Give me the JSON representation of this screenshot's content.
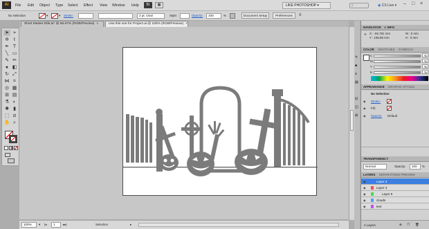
{
  "app": {
    "logo": "Ai",
    "workspace": "LIKE PHOTOSHOP",
    "cs_live": "CS Live"
  },
  "menu": [
    "File",
    "Edit",
    "Object",
    "Type",
    "Select",
    "Effect",
    "View",
    "Window",
    "Help"
  ],
  "control": {
    "selection_label": "No Selection",
    "stroke_label": "Stroke:",
    "brush": "2 pt. Oval",
    "style_label": "Style:",
    "opacity_label": "Opacity:",
    "opacity_value": "100",
    "opacity_unit": "%",
    "doc_setup": "Document Setup",
    "preferences": "Preferences"
  },
  "doc_tabs": [
    {
      "label": "Short Master Ebb.ai* @ 66.67% (RGB/Preview)"
    },
    {
      "label": "Use this one for Project.ai @ 100% (RGB/Preview)"
    }
  ],
  "status": {
    "zoom": "100%",
    "page": "1",
    "mode": "Selection"
  },
  "navigator": {
    "tabs": [
      "NAVIGATOR",
      "INFO"
    ],
    "x": "X : -92.781 mm",
    "y": "Y : 196.85 mm",
    "w": "W : 0 mm",
    "h": "H : 0 mm"
  },
  "color_panel": {
    "tabs": [
      "COLOR",
      "SWATCHES",
      "SYMBOLS"
    ],
    "channels": [
      {
        "label": "C",
        "value": "",
        "unit": "%"
      },
      {
        "label": "M",
        "value": "",
        "unit": "%"
      },
      {
        "label": "Y",
        "value": "",
        "unit": "%"
      },
      {
        "label": "K",
        "value": "",
        "unit": "%"
      }
    ]
  },
  "appearance": {
    "tabs": [
      "APPEARANCE",
      "GRAPHIC STYLES"
    ],
    "header": "No Selection",
    "stroke": "Stroke:",
    "fill": "Fill:",
    "opacity": "Opacity:",
    "opacity_value": "Default"
  },
  "transparency": {
    "title": "TRANSPARENCY",
    "mode": "Normal",
    "opacity_label": "Opacity:",
    "opacity_value": "100",
    "opacity_unit": "%"
  },
  "layers": {
    "tabs": [
      "LAYERS",
      "SEPARATIONS PREVIEW"
    ],
    "items": [
      {
        "name": "Layer 3",
        "selected": true,
        "color": "#3a7bff",
        "indent": 0
      },
      {
        "name": "Layer 3",
        "selected": false,
        "color": "#ff4a4a",
        "indent": 0
      },
      {
        "name": "Layer 5",
        "selected": false,
        "color": "#4adb4a",
        "indent": 1
      },
      {
        "name": "clouds",
        "selected": false,
        "color": "#4aa0ff",
        "indent": 0
      },
      {
        "name": "text",
        "selected": false,
        "color": "#c74aff",
        "indent": 0
      }
    ],
    "count": "4 Layers"
  }
}
